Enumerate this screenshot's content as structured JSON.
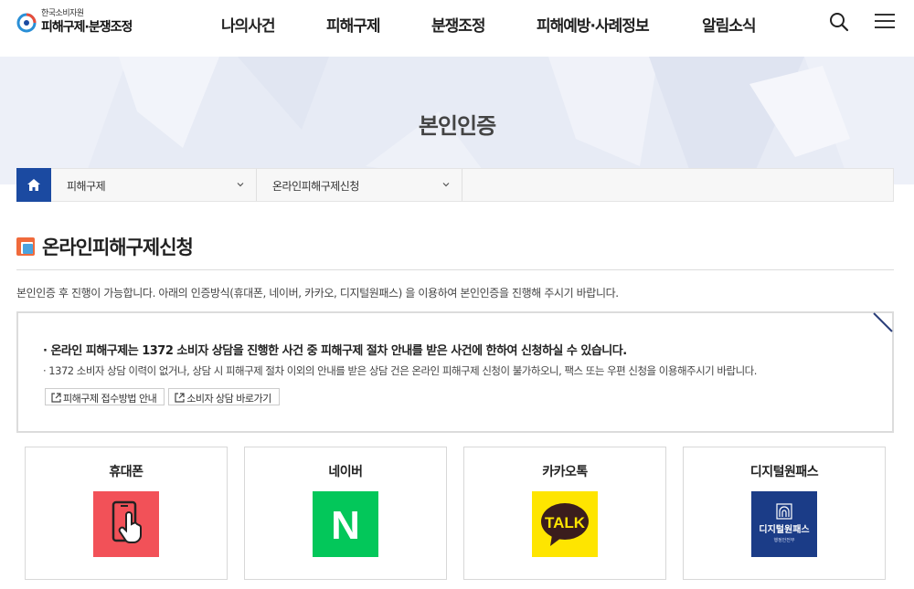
{
  "header": {
    "logo_small": "한국소비자원",
    "logo_big": "피해구제·분쟁조정",
    "nav": [
      "나의사건",
      "피해구제",
      "분쟁조정",
      "피해예방·사례정보",
      "알림소식"
    ]
  },
  "banner": {
    "title": "본인인증"
  },
  "breadcrumb": {
    "level1": "피해구제",
    "level2": "온라인피해구제신청"
  },
  "section": {
    "title": "온라인피해구제신청",
    "description": "본인인증 후 진행이 가능합니다. 아래의 인증방식(휴대폰, 네이버, 카카오, 디지털원패스) 을 이용하여 본인인증을 진행해 주시기 바랍니다."
  },
  "notice": {
    "line1": "· 온라인 피해구제는 1372 소비자 상담을 진행한 사건 중 피해구제 절차 안내를 받은 사건에 한하여 신청하실 수 있습니다.",
    "line2": "· 1372 소비자 상담 이력이 없거나, 상담 시 피해구제 절차 이외의 안내를 받은 상담 건은 온라인 피해구제 신청이 불가하오니, 팩스 또는 우편 신청을 이용해주시기 바랍니다.",
    "link1": "피해구제 접수방법 안내",
    "link2": "소비자 상담 바로가기"
  },
  "auth_methods": {
    "phone": {
      "label": "휴대폰",
      "color": "#f25158"
    },
    "naver": {
      "label": "네이버",
      "color": "#03c75a",
      "icon_text": "N"
    },
    "kakao": {
      "label": "카카오톡",
      "color": "#fee500",
      "icon_text": "TALK"
    },
    "digital": {
      "label": "디지털원패스",
      "color": "#1b3c87",
      "icon_text": "디지털원패스",
      "icon_subtext": "행정안전부"
    }
  }
}
